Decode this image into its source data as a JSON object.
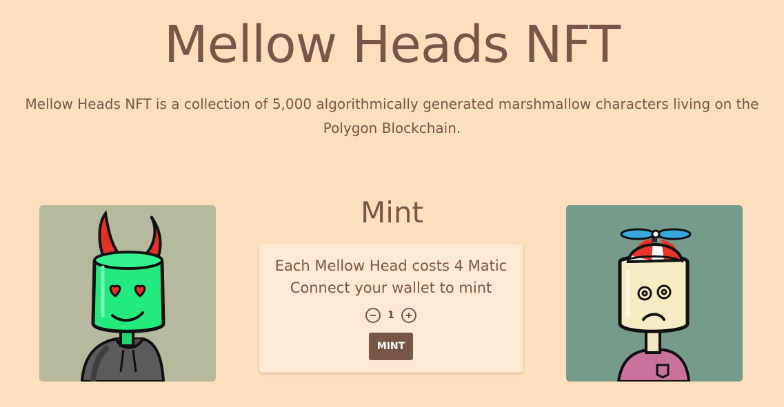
{
  "header": {
    "title": "Mellow Heads NFT",
    "description": "Mellow Heads NFT is a collection of 5,000 algorithmically generated marshmallow characters living on the Polygon Blockchain."
  },
  "mint": {
    "heading": "Mint",
    "price_text": "Each Mellow Head costs 4 Matic",
    "wallet_text": "Connect your wallet to mint",
    "quantity": "1",
    "button_label": "MINT"
  },
  "colors": {
    "background": "#fcdfbf",
    "text": "#7a5548",
    "card": "#fde9d5",
    "button": "#795548"
  },
  "images": [
    {
      "name": "devil-mellow-head",
      "background": "#b7b99f"
    },
    {
      "name": "propeller-cap-mellow-head",
      "background": "#779b8a"
    }
  ]
}
